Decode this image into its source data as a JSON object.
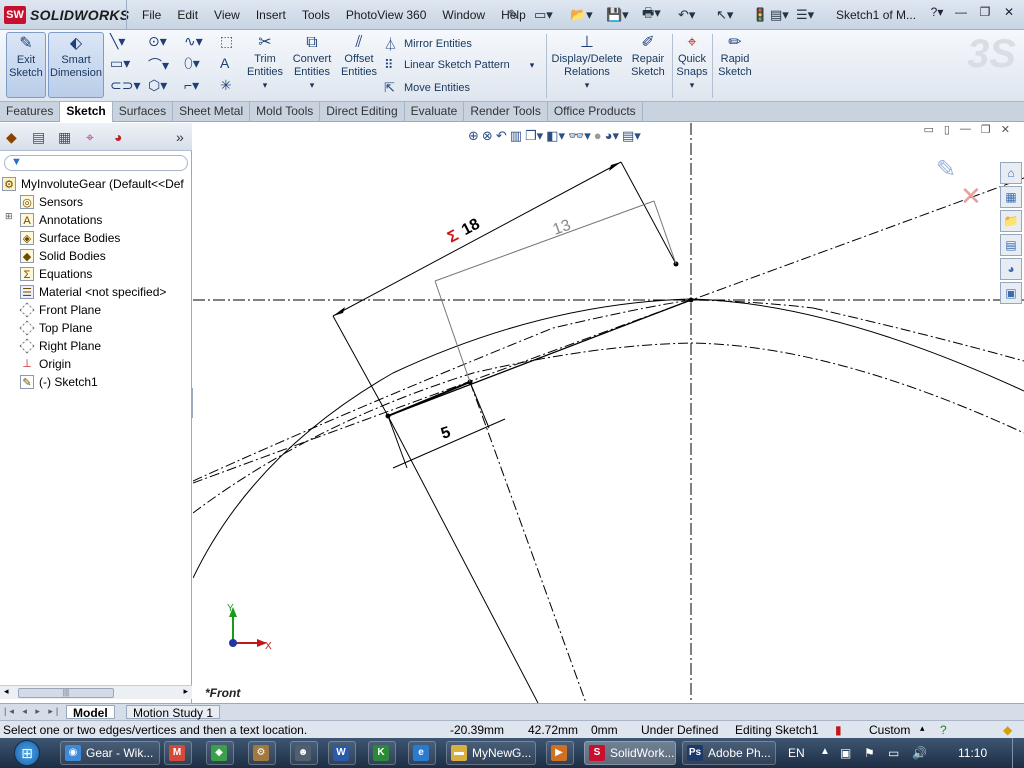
{
  "app": {
    "name": "SOLIDWORKS",
    "badge": "SW",
    "doc_title": "Sketch1 of M..."
  },
  "menu": [
    "File",
    "Edit",
    "View",
    "Insert",
    "Tools",
    "PhotoView 360",
    "Window",
    "Help"
  ],
  "ribbon": {
    "exit_sketch": "Exit Sketch",
    "smart_dimension": "Smart Dimension",
    "trim_entities": "Trim Entities",
    "convert_entities": "Convert Entities",
    "offset_entities": "Offset Entities",
    "mirror_entities": "Mirror Entities",
    "linear_pattern": "Linear Sketch Pattern",
    "move_entities": "Move Entities",
    "display_delete_relations": "Display/Delete Relations",
    "repair_sketch": "Repair Sketch",
    "quick_snaps": "Quick Snaps",
    "rapid_sketch": "Rapid Sketch"
  },
  "tabs": [
    "Features",
    "Sketch",
    "Surfaces",
    "Sheet Metal",
    "Mold Tools",
    "Direct Editing",
    "Evaluate",
    "Render Tools",
    "Office Products"
  ],
  "active_tab": "Sketch",
  "tree": {
    "root": "MyInvoluteGear  (Default<<Def",
    "items": [
      "Sensors",
      "Annotations",
      "Surface Bodies",
      "Solid Bodies",
      "Equations",
      "Material <not specified>",
      "Front Plane",
      "Top Plane",
      "Right Plane",
      "Origin",
      "(-) Sketch1"
    ]
  },
  "sketch": {
    "dim_18": "18",
    "dim_13": "13",
    "dim_5": "5",
    "sigma": "Σ",
    "view_label": "*Front",
    "axis_x": "X",
    "axis_y": "Y"
  },
  "bottom_tabs": [
    "Model",
    "Motion Study 1"
  ],
  "status": {
    "message": "Select one or two edges/vertices and then a text location.",
    "x": "-20.39mm",
    "y": "42.72mm",
    "z": "0mm",
    "state": "Under Defined",
    "editing": "Editing Sketch1",
    "units": "Custom"
  },
  "taskbar": {
    "items": [
      "Gear - Wik...",
      "MyNewG...",
      "SolidWork...",
      "Adobe Ph..."
    ],
    "lang": "EN",
    "clock": "11:10"
  },
  "colors": {
    "accent": "#c8102e",
    "ribbon_text": "#17365d",
    "sigma": "#d0121b"
  }
}
